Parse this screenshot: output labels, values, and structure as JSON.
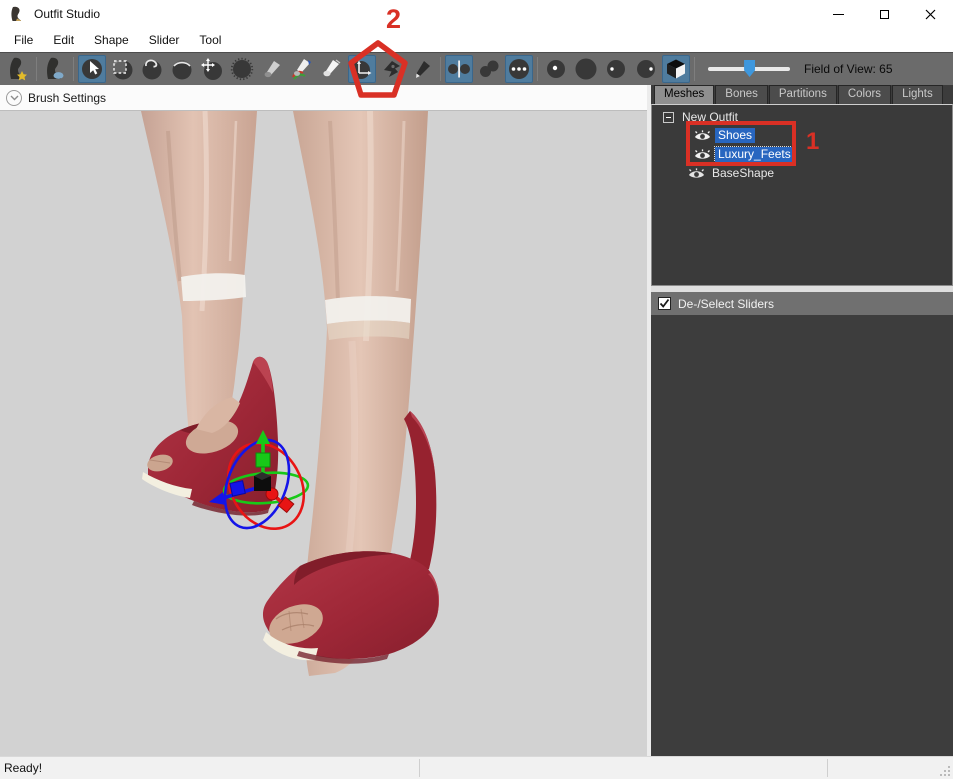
{
  "window": {
    "title": "Outfit Studio"
  },
  "menu": {
    "file": "File",
    "edit": "Edit",
    "shape": "Shape",
    "slider": "Slider",
    "tool": "Tool"
  },
  "toolbar": {
    "fov_label": "Field of View: 65",
    "fov_value": 65,
    "tools": [
      {
        "name": "new-project-icon",
        "active": false
      },
      {
        "name": "load-project-icon",
        "active": false
      },
      {
        "name": "select-tool-icon",
        "active": true
      },
      {
        "name": "mask-brush-icon",
        "active": false
      },
      {
        "name": "inflate-brush-icon",
        "active": false
      },
      {
        "name": "deflate-brush-icon",
        "active": false
      },
      {
        "name": "move-brush-icon",
        "active": false
      },
      {
        "name": "smooth-brush-icon",
        "active": false
      },
      {
        "name": "weight-brush-icon",
        "active": false
      },
      {
        "name": "color-brush-icon",
        "active": false
      },
      {
        "name": "alpha-brush-icon",
        "active": false
      },
      {
        "name": "transform-tool-icon",
        "active": true
      },
      {
        "name": "pivot-tool-icon",
        "active": false
      },
      {
        "name": "vertex-edit-icon",
        "active": false
      },
      {
        "name": "mirror-x-icon",
        "active": true
      },
      {
        "name": "edit-connected-icon",
        "active": false
      },
      {
        "name": "global-brush-icon",
        "active": true
      },
      {
        "name": "brush-size-small-icon",
        "active": false
      },
      {
        "name": "brush-size-large-icon",
        "active": false
      },
      {
        "name": "brush-strength-low-icon",
        "active": false
      },
      {
        "name": "brush-strength-high-icon",
        "active": false
      },
      {
        "name": "perspective-toggle-icon",
        "active": true
      }
    ]
  },
  "left_panel": {
    "brush_settings_label": "Brush Settings"
  },
  "right_panel": {
    "tabs": {
      "meshes": "Meshes",
      "bones": "Bones",
      "partitions": "Partitions",
      "colors": "Colors",
      "lights": "Lights"
    },
    "tree": {
      "root": "New Outfit",
      "items": [
        {
          "label": "Shoes",
          "selected": true
        },
        {
          "label": "Luxury_Feets",
          "selected": true,
          "focused": true
        },
        {
          "label": "BaseShape",
          "selected": false
        }
      ]
    },
    "sliders_toggle": {
      "label": "De-/Select Sliders",
      "checked": true
    }
  },
  "statusbar": {
    "message": "Ready!"
  },
  "annotations": {
    "step1": "1",
    "step2": "2"
  },
  "colors": {
    "selection_blue": "#2866c0",
    "tool_active_blue": "#4f7c9e",
    "annotation_red": "#d93025",
    "viewport_bg": "#d2d2d2",
    "shoe_red": "#a62a38"
  }
}
